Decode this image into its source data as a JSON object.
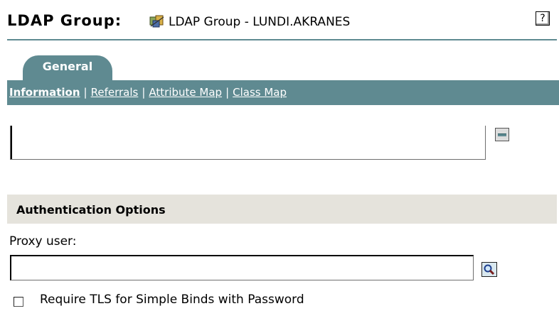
{
  "header": {
    "title": "LDAP Group:",
    "object_name": "LDAP Group - LUNDI.AKRANES",
    "object_icon": "ldap-group-icon",
    "help_label": "?"
  },
  "tabs": [
    {
      "label": "General",
      "active": true
    }
  ],
  "subnav": {
    "items": [
      {
        "label": "Information",
        "active": true
      },
      {
        "label": "Referrals",
        "active": false
      },
      {
        "label": "Attribute Map",
        "active": false
      },
      {
        "label": "Class Map",
        "active": false
      }
    ],
    "separator": "|"
  },
  "list_box": {
    "remove_icon": "remove-icon"
  },
  "authentication": {
    "section_title": "Authentication Options",
    "proxy_user_label": "Proxy user:",
    "proxy_user_value": "",
    "browse_icon": "browse-search-icon",
    "require_tls_label": "Require TLS for Simple Binds with Password",
    "require_tls_checked": false
  },
  "colors": {
    "accent": "#5f8a91",
    "section_bg": "#e5e3dc"
  }
}
